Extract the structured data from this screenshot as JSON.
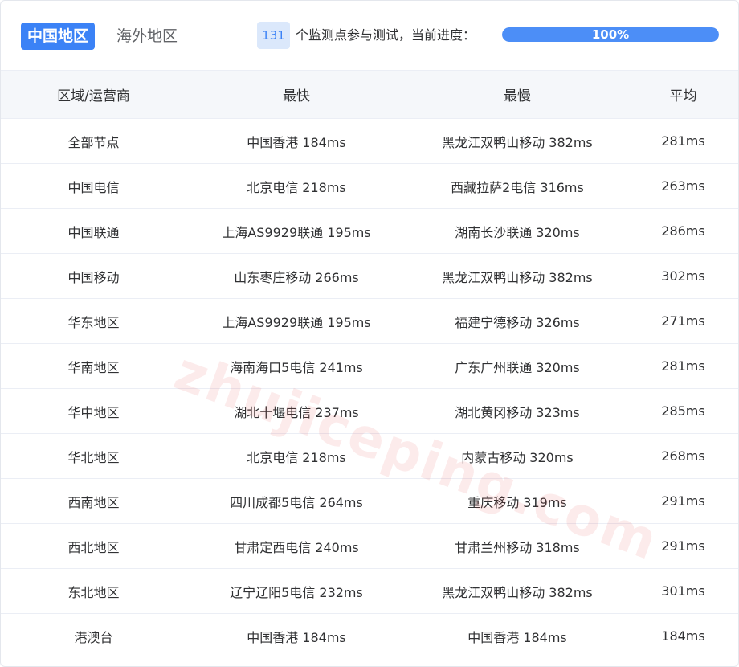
{
  "tabs": [
    {
      "label": "中国地区",
      "active": true
    },
    {
      "label": "海外地区",
      "active": false
    }
  ],
  "monitor": {
    "count": "131",
    "text": "个监测点参与测试，当前进度：",
    "progress_label": "100%",
    "progress_percent": 100
  },
  "colors": {
    "accent": "#3b82f6",
    "progress": "#4c8ef7",
    "watermark": "#e63c3c"
  },
  "watermark": "zhujiceping.com",
  "table": {
    "headers": [
      "区域/运营商",
      "最快",
      "最慢",
      "平均"
    ],
    "rows": [
      [
        "全部节点",
        "中国香港 184ms",
        "黑龙江双鸭山移动 382ms",
        "281ms"
      ],
      [
        "中国电信",
        "北京电信 218ms",
        "西藏拉萨2电信 316ms",
        "263ms"
      ],
      [
        "中国联通",
        "上海AS9929联通 195ms",
        "湖南长沙联通 320ms",
        "286ms"
      ],
      [
        "中国移动",
        "山东枣庄移动 266ms",
        "黑龙江双鸭山移动 382ms",
        "302ms"
      ],
      [
        "华东地区",
        "上海AS9929联通 195ms",
        "福建宁德移动 326ms",
        "271ms"
      ],
      [
        "华南地区",
        "海南海口5电信 241ms",
        "广东广州联通 320ms",
        "281ms"
      ],
      [
        "华中地区",
        "湖北十堰电信 237ms",
        "湖北黄冈移动 323ms",
        "285ms"
      ],
      [
        "华北地区",
        "北京电信 218ms",
        "内蒙古移动 320ms",
        "268ms"
      ],
      [
        "西南地区",
        "四川成都5电信 264ms",
        "重庆移动 319ms",
        "291ms"
      ],
      [
        "西北地区",
        "甘肃定西电信 240ms",
        "甘肃兰州移动 318ms",
        "291ms"
      ],
      [
        "东北地区",
        "辽宁辽阳5电信 232ms",
        "黑龙江双鸭山移动 382ms",
        "301ms"
      ],
      [
        "港澳台",
        "中国香港 184ms",
        "中国香港 184ms",
        "184ms"
      ]
    ]
  }
}
